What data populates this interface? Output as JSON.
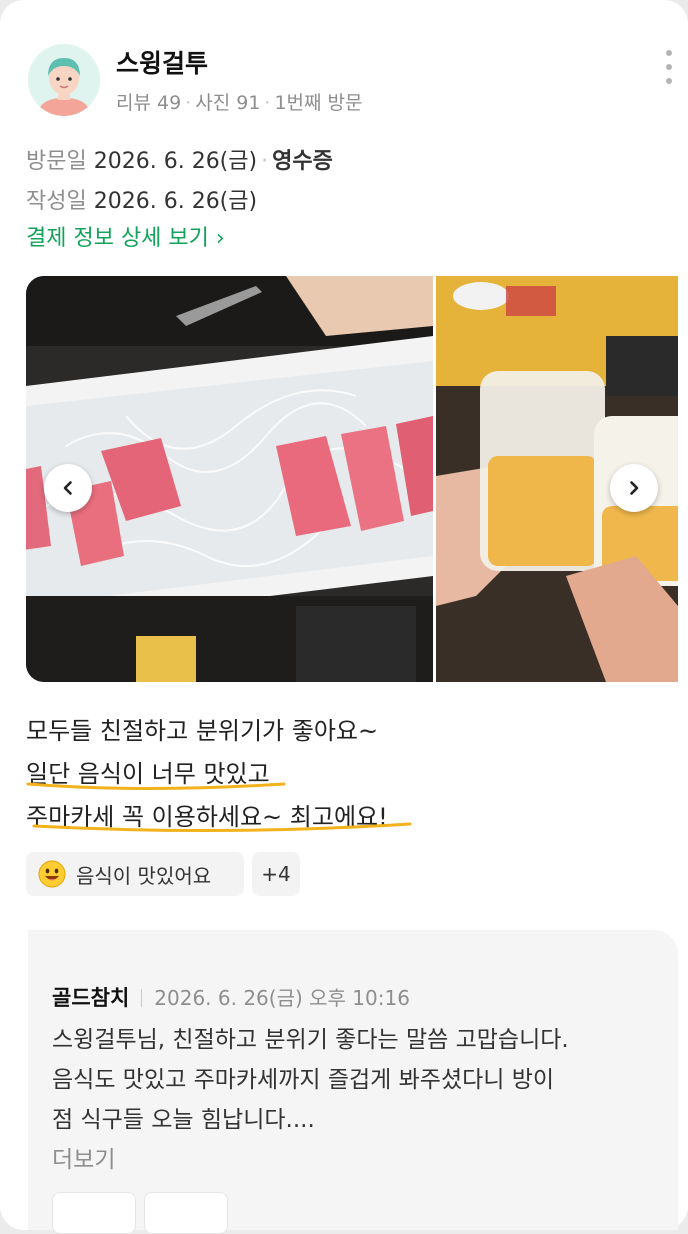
{
  "reviewer": {
    "name": "스윙걸투",
    "stat_reviews": "리뷰 49",
    "stat_photos": "사진 91",
    "stat_visit": "1번째 방문"
  },
  "visit": {
    "label": "방문일",
    "date": "2026. 6. 26(금)",
    "receipt": "영수증"
  },
  "written": {
    "label": "작성일",
    "date": "2026. 6. 26(금)"
  },
  "payment_detail_link": "결제 정보 상세 보기 ›",
  "review_lines": [
    "모두들 친절하고 분위기가 좋아요~",
    "일단 음식이 너무 맛있고",
    "주마카세 꼭 이용하세요~ 최고에요!"
  ],
  "keyword_chip": "음식이 맛있어요",
  "more_chip": "+4",
  "owner_reply": {
    "name": "골드참치",
    "date": "2026. 6. 26(금) 오후 10:16",
    "lines": [
      "스윙걸투님, 친절하고 분위기 좋다는 말씀 고맙습니다.",
      "음식도 맛있고 주마카세까지 즐겁게 봐주셨다니 방이",
      "점 식구들 오늘 힘납니다...."
    ],
    "more_label": "더보기"
  },
  "icons": {
    "prev": "chevron-left-icon",
    "next": "chevron-right-icon",
    "menu": "more-vertical-icon",
    "keyword": "smiley-emoji-icon"
  },
  "colors": {
    "link_green": "#11a35a",
    "underline_yellow": "#f3b11c"
  }
}
